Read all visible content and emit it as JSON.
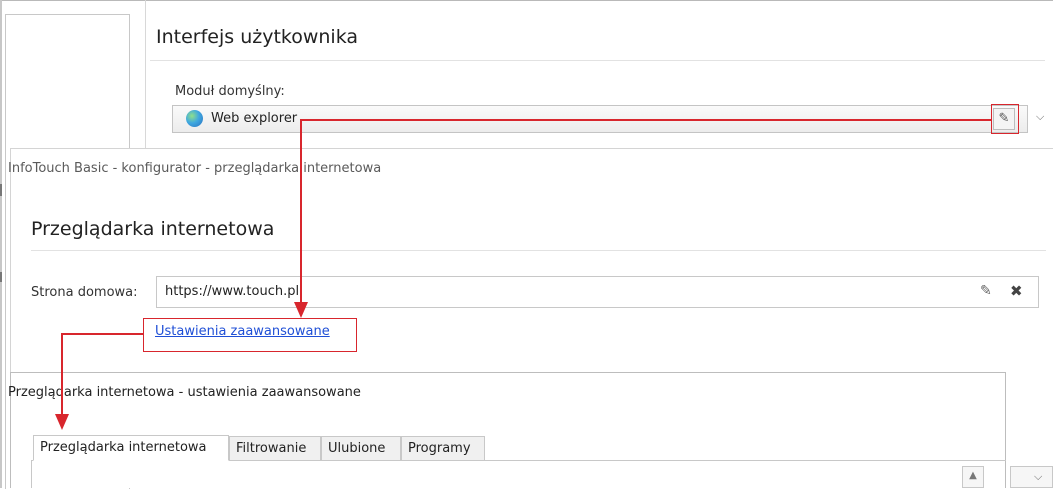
{
  "background": {
    "section_title": "Interfejs użytkownika",
    "module_label": "Moduł domyślny:",
    "module_value": "Web explorer",
    "module_icon": "globe-icon",
    "edit_icon": "edit-icon",
    "chevron_icon": "chevron-down-icon"
  },
  "configurator": {
    "window_title": "InfoTouch Basic - konfigurator - przeglądarka internetowa",
    "heading": "Przeglądarka internetowa",
    "home_label": "Strona domowa:",
    "home_value": "https://www.touch.pl",
    "edit_icon": "edit-icon",
    "clear_icon": "close-icon",
    "advanced_link": "Ustawienia zaawansowane"
  },
  "advanced": {
    "window_title": "Przeglądarka internetowa - ustawienia zaawansowane",
    "tabs": [
      {
        "label": "Przeglądarka internetowa",
        "active": true
      },
      {
        "label": "Filtrowanie",
        "active": false
      },
      {
        "label": "Ulubione",
        "active": false
      },
      {
        "label": "Programy",
        "active": false
      }
    ]
  },
  "annotation_color": "#d8262d"
}
